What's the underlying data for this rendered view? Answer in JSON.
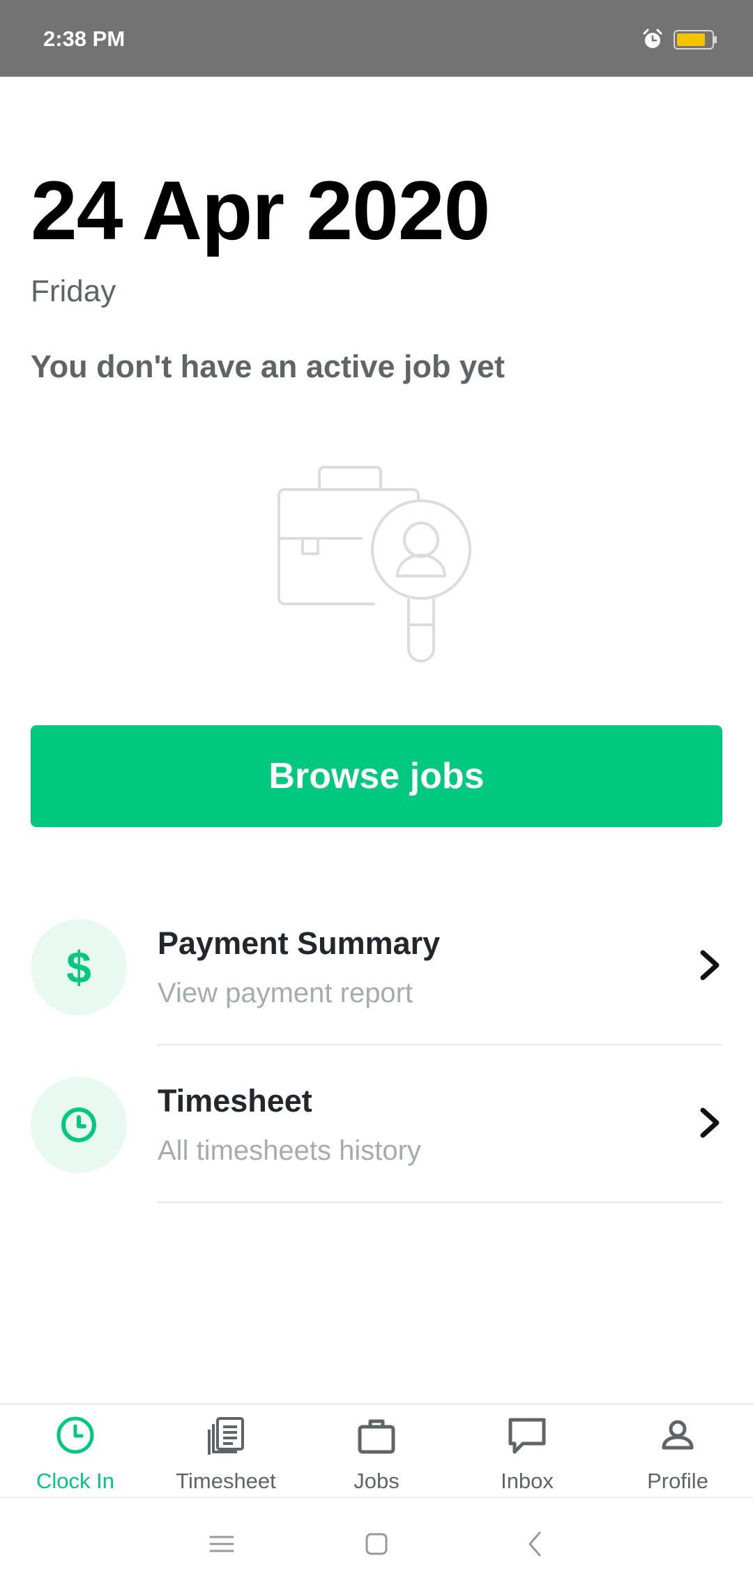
{
  "status_bar": {
    "time": "2:38 PM",
    "icons": [
      "alarm-icon",
      "battery-icon"
    ],
    "battery_color": "#f5c400"
  },
  "header": {
    "date": "24 Apr 2020",
    "weekday": "Friday",
    "empty_message": "You don't have an active job yet"
  },
  "illustration": {
    "icon": "briefcase-search-icon"
  },
  "browse_button": {
    "label": "Browse jobs",
    "color": "#00c97f"
  },
  "list": [
    {
      "icon": "dollar-icon",
      "glyph": "$",
      "title": "Payment Summary",
      "subtitle": "View payment report"
    },
    {
      "icon": "clock-icon",
      "title": "Timesheet",
      "subtitle": "All timesheets history"
    }
  ],
  "bottom_nav": [
    {
      "label": "Clock In",
      "icon": "clock-icon",
      "active": true
    },
    {
      "label": "Timesheet",
      "icon": "document-icon",
      "active": false
    },
    {
      "label": "Jobs",
      "icon": "briefcase-icon",
      "active": false
    },
    {
      "label": "Inbox",
      "icon": "chat-icon",
      "active": false
    },
    {
      "label": "Profile",
      "icon": "person-icon",
      "active": false
    }
  ],
  "system_nav": [
    "menu-icon",
    "home-icon",
    "back-icon"
  ],
  "colors": {
    "accent": "#00c97f",
    "accent_light": "#e8f9f1",
    "status_bar": "#737373"
  }
}
